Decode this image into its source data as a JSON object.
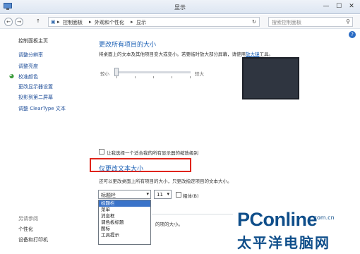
{
  "window": {
    "title": "显示",
    "minimize": "—",
    "maximize": "☐",
    "close": "✕"
  },
  "address": {
    "back": "←",
    "forward": "→",
    "up": "↑",
    "crumbs": [
      "控制面板",
      "外观和个性化",
      "显示"
    ],
    "separator": "▸",
    "refresh": "↻",
    "search_placeholder": "搜索控制面板",
    "search_icon": "⚲"
  },
  "help": "?",
  "sidebar": {
    "home": "控制面板主页",
    "items": [
      "调整分辨率",
      "调整亮度",
      "校准颜色",
      "更改显示器设置",
      "投影到第二屏幕",
      "调整 ClearType 文本"
    ],
    "see_also": "另请参阅",
    "bottom_items": [
      "个性化",
      "设备和打印机"
    ]
  },
  "main": {
    "heading1": "更改所有项目的大小",
    "desc1": "将桌面上的文本及其他项目变大或变小。若要临时放大部分屏幕，请使用",
    "desc1_link": "放大镜",
    "desc1_tail": "工具。",
    "slider": {
      "min_label": "较小",
      "max_label": "较大",
      "level": 0
    },
    "checkbox1_label": "让我选择一个适合我的所有显示器的缩放级别",
    "heading2": "仅更改文本大小",
    "desc2": "还可以更改桌面上所有项目的大小，只更改指定项目的文本大小。",
    "element_select": "标题栏",
    "size_select": "11",
    "bold_label": "粗体(B)",
    "dropdown_options": [
      "标题栏",
      "菜单",
      "消息框",
      "调色板标题",
      "图标",
      "工具提示"
    ],
    "dropdown_selected": 0,
    "partial_text": "的项的大小。"
  },
  "logo": {
    "brand_p": "PC",
    "brand_online": "online",
    "domain": ".com.cn",
    "cn": "太平洋电脑网"
  }
}
